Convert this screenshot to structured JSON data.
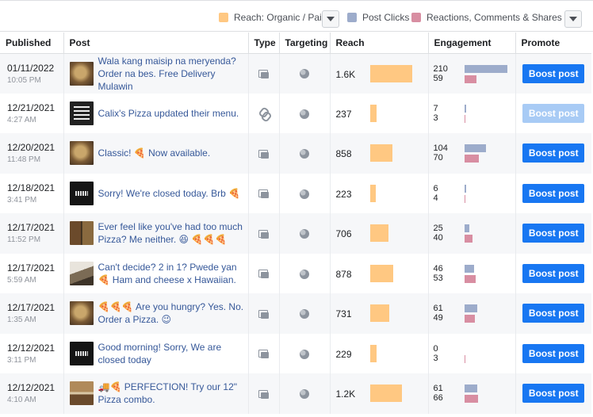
{
  "legend": {
    "reach": "Reach: Organic / Paid",
    "clicks": "Post Clicks",
    "reactions": "Reactions, Comments & Shares",
    "colors": {
      "reach": "#ffc882",
      "clicks": "#9daccb",
      "reactions": "#d88ea2"
    }
  },
  "columns": {
    "published": "Published",
    "post": "Post",
    "type": "Type",
    "targeting": "Targeting",
    "reach": "Reach",
    "engagement": "Engagement",
    "promote": "Promote"
  },
  "rows": [
    {
      "date": "01/11/2022",
      "time": "10:05 PM",
      "thumb": "food",
      "text": "Wala kang maisip na meryenda? Order na bes. Free Delivery Mulawin",
      "type": "album-icon",
      "reach": "1.6K",
      "reach_value": 1600,
      "clicks": "210",
      "reactions": "59",
      "boost": "Boost post",
      "boost_enabled": true
    },
    {
      "date": "12/21/2021",
      "time": "4:27 AM",
      "thumb": "menu",
      "text": "Calix's Pizza updated their menu.",
      "type": "link-icon",
      "reach": "237",
      "reach_value": 237,
      "clicks": "7",
      "reactions": "3",
      "boost": "Boost post",
      "boost_enabled": false
    },
    {
      "date": "12/20/2021",
      "time": "11:48 PM",
      "thumb": "food",
      "text": "Classic! 🍕 Now available.",
      "type": "album-icon",
      "reach": "858",
      "reach_value": 858,
      "clicks": "104",
      "reactions": "70",
      "boost": "Boost post",
      "boost_enabled": true
    },
    {
      "date": "12/18/2021",
      "time": "3:41 PM",
      "thumb": "dark",
      "text": "Sorry! We're closed today. Brb 🍕",
      "type": "album-icon",
      "reach": "223",
      "reach_value": 223,
      "clicks": "6",
      "reactions": "4",
      "boost": "Boost post",
      "boost_enabled": true
    },
    {
      "date": "12/17/2021",
      "time": "11:52 PM",
      "thumb": "grid",
      "text": "Ever feel like you've had too much Pizza? Me neither. 😆 🍕🍕🍕",
      "type": "album-icon",
      "reach": "706",
      "reach_value": 706,
      "clicks": "25",
      "reactions": "40",
      "boost": "Boost post",
      "boost_enabled": true
    },
    {
      "date": "12/17/2021",
      "time": "5:59 AM",
      "thumb": "photo",
      "text": "Can't decide? 2 in 1? Pwede yan 🍕 Ham and cheese x Hawaiian.",
      "type": "album-icon",
      "reach": "878",
      "reach_value": 878,
      "clicks": "46",
      "reactions": "53",
      "boost": "Boost post",
      "boost_enabled": true
    },
    {
      "date": "12/17/2021",
      "time": "1:35 AM",
      "thumb": "food",
      "text": "🍕🍕🍕 Are you hungry? Yes. No. Order a Pizza. 😉",
      "type": "album-icon",
      "reach": "731",
      "reach_value": 731,
      "clicks": "61",
      "reactions": "49",
      "boost": "Boost post",
      "boost_enabled": true
    },
    {
      "date": "12/12/2021",
      "time": "3:11 PM",
      "thumb": "dark",
      "text": "Good morning! Sorry, We are closed today",
      "type": "album-icon",
      "reach": "229",
      "reach_value": 229,
      "clicks": "0",
      "reactions": "3",
      "boost": "Boost post",
      "boost_enabled": true
    },
    {
      "date": "12/12/2021",
      "time": "4:10 AM",
      "thumb": "combo",
      "text": "🚚🍕 PERFECTION! Try our 12\" Pizza combo.",
      "type": "album-icon",
      "reach": "1.2K",
      "reach_value": 1200,
      "clicks": "61",
      "reactions": "66",
      "boost": "Boost post",
      "boost_enabled": true
    }
  ]
}
